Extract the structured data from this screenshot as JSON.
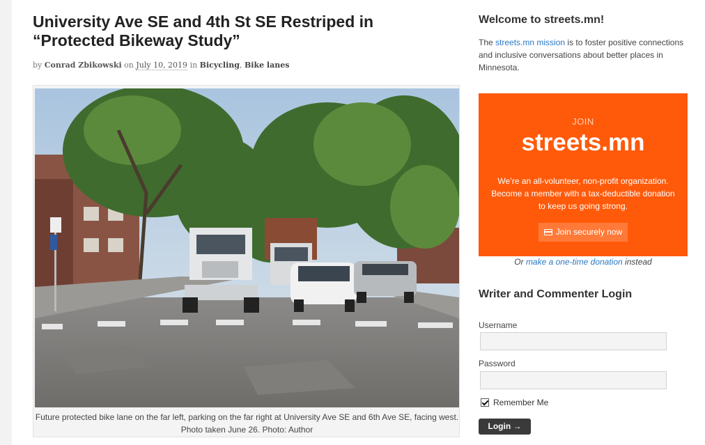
{
  "article": {
    "title_line1": "University Ave SE and 4th St SE Restriped in",
    "title_line2": "“Protected Bikeway Study”",
    "by": "by",
    "author": "Conrad Zbikowski",
    "on": "on",
    "date": "July 10, 2019",
    "in": "in",
    "category1": "Bicycling",
    "category_sep": ",",
    "category2": "Bike lanes",
    "caption_line1": "Future protected bike lane on the far left, parking on the far right at University Ave SE and 6th Ave SE, facing west.",
    "caption_line2": "Photo taken June 26. Photo: Author"
  },
  "sidebar": {
    "welcome_heading": "Welcome to streets.mn!",
    "welcome_pre": "The",
    "welcome_link": "streets.mn mission",
    "welcome_post": "is to foster positive connections and inclusive conversations about better places in Minnesota.",
    "join": {
      "label": "JOIN",
      "brand": "streets.mn",
      "desc_line1": "We’re an all-volunteer, non-profit organization.",
      "desc_line2": "Become a member with a tax-deductible donation",
      "desc_line3": "to keep us going strong.",
      "button": "Join securely now",
      "button_icon": "credit-card-icon"
    },
    "onetime_pre": "Or",
    "onetime_link": "make a one-time donation",
    "onetime_post": "instead",
    "login_heading": "Writer and Commenter Login",
    "username_label": "Username",
    "username_value": "",
    "password_label": "Password",
    "password_value": "",
    "remember_label": "Remember Me",
    "remember_checked": true,
    "login_button": "Login →"
  },
  "colors": {
    "join_bg": "#ff5a0a",
    "link": "#2b78c2",
    "login_btn": "#3a3a3a"
  }
}
